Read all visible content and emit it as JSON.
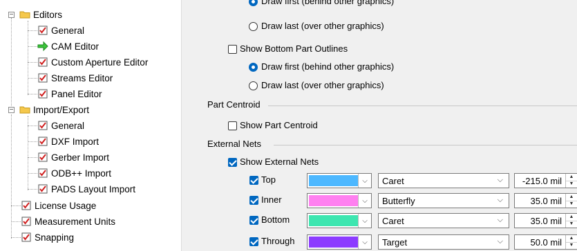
{
  "tree": {
    "items": [
      {
        "label": "Editors",
        "icon": "folder-icon"
      },
      {
        "label": "General",
        "icon": "checklist-icon"
      },
      {
        "label": "CAM Editor",
        "icon": "arrow-right-icon"
      },
      {
        "label": "Custom Aperture Editor",
        "icon": "checklist-icon"
      },
      {
        "label": "Streams Editor",
        "icon": "checklist-icon"
      },
      {
        "label": "Panel Editor",
        "icon": "checklist-icon"
      },
      {
        "label": "Import/Export",
        "icon": "folder-icon"
      },
      {
        "label": "General",
        "icon": "checklist-icon"
      },
      {
        "label": "DXF Import",
        "icon": "checklist-icon"
      },
      {
        "label": "Gerber Import",
        "icon": "checklist-icon"
      },
      {
        "label": "ODB++ Import",
        "icon": "checklist-icon"
      },
      {
        "label": "PADS Layout Import",
        "icon": "checklist-icon"
      },
      {
        "label": "License Usage",
        "icon": "checklist-icon"
      },
      {
        "label": "Measurement Units",
        "icon": "checklist-icon"
      },
      {
        "label": "Snapping",
        "icon": "checklist-icon"
      }
    ]
  },
  "panel": {
    "top_partial": {
      "radio_first": "Draw first (behind other graphics)",
      "radio_last": "Draw last (over other graphics)"
    },
    "bottom_outlines": {
      "checkbox": "Show Bottom Part Outlines",
      "radio_first": "Draw first (behind other graphics)",
      "radio_last": "Draw last (over other graphics)"
    },
    "part_centroid": {
      "group": "Part Centroid",
      "checkbox": "Show Part Centroid"
    },
    "external_nets": {
      "group": "External Nets",
      "checkbox": "Show External Nets",
      "rows": [
        {
          "label": "Top",
          "color": "#4db8ff",
          "style": "Caret",
          "width": "-215.0 mil"
        },
        {
          "label": "Inner",
          "color": "#ff80f0",
          "style": "Butterfly",
          "width": "35.0 mil"
        },
        {
          "label": "Bottom",
          "color": "#3de6b0",
          "style": "Caret",
          "width": "35.0 mil"
        },
        {
          "label": "Through",
          "color": "#8c3cff",
          "style": "Target",
          "width": "50.0 mil"
        }
      ]
    }
  },
  "colors": {
    "accent": "#0067c0",
    "panel_bg": "#f0f0f0"
  }
}
